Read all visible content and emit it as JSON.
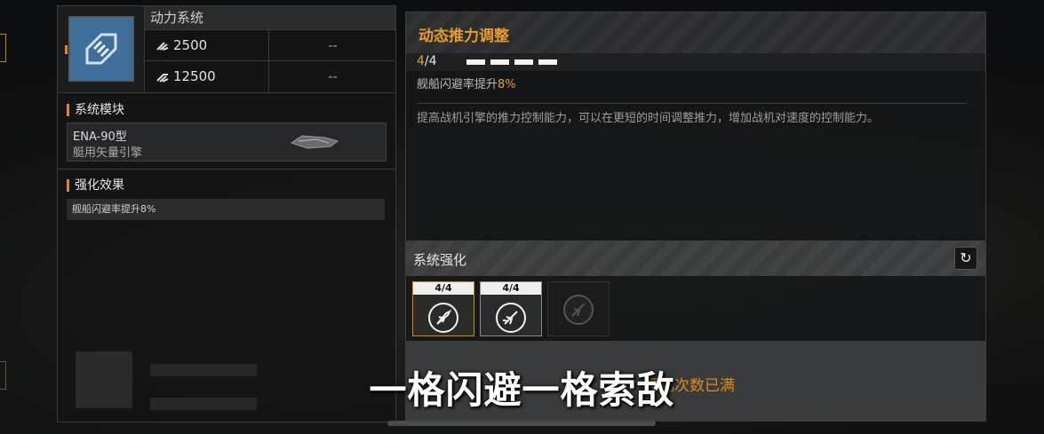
{
  "left_panel": {
    "system_title": "动力系统",
    "stats": [
      {
        "icon": "thrust-icon",
        "value": "2500",
        "next": "--"
      },
      {
        "icon": "boost-icon",
        "value": "12500",
        "next": "--"
      }
    ],
    "module_section_title": "系统模块",
    "module": {
      "name": "ENA-90型",
      "type": "艇用矢量引擎",
      "icon": "vector-engine-icon"
    },
    "effect_section_title": "强化效果",
    "effect_text": "舰船闪避率提升8%"
  },
  "detail": {
    "title": "动态推力调整",
    "level_current": "4",
    "level_sep_max": "/4",
    "pips_filled": 4,
    "bonus_prefix": "舰船闪避率提升",
    "bonus_value": "8%",
    "description": "提高战机引擎的推力控制能力，可以在更短的时间调整推力，增加战机对速度的控制能力。"
  },
  "enhance": {
    "title": "系统强化",
    "refresh_icon": "refresh-icon",
    "slots": [
      {
        "label": "4/4",
        "icon": "jet-dodge-icon",
        "state": "selected"
      },
      {
        "label": "4/4",
        "icon": "jet-boost-icon",
        "state": "completed"
      },
      {
        "label": "",
        "icon": "jet-locked-icon",
        "state": "locked"
      }
    ],
    "status_message": "强化次数已满"
  },
  "subtitle": "一格闪避一格索敌",
  "colors": {
    "accent": "#e89a2c",
    "panel": "#161718",
    "border": "#3a3b3d"
  }
}
